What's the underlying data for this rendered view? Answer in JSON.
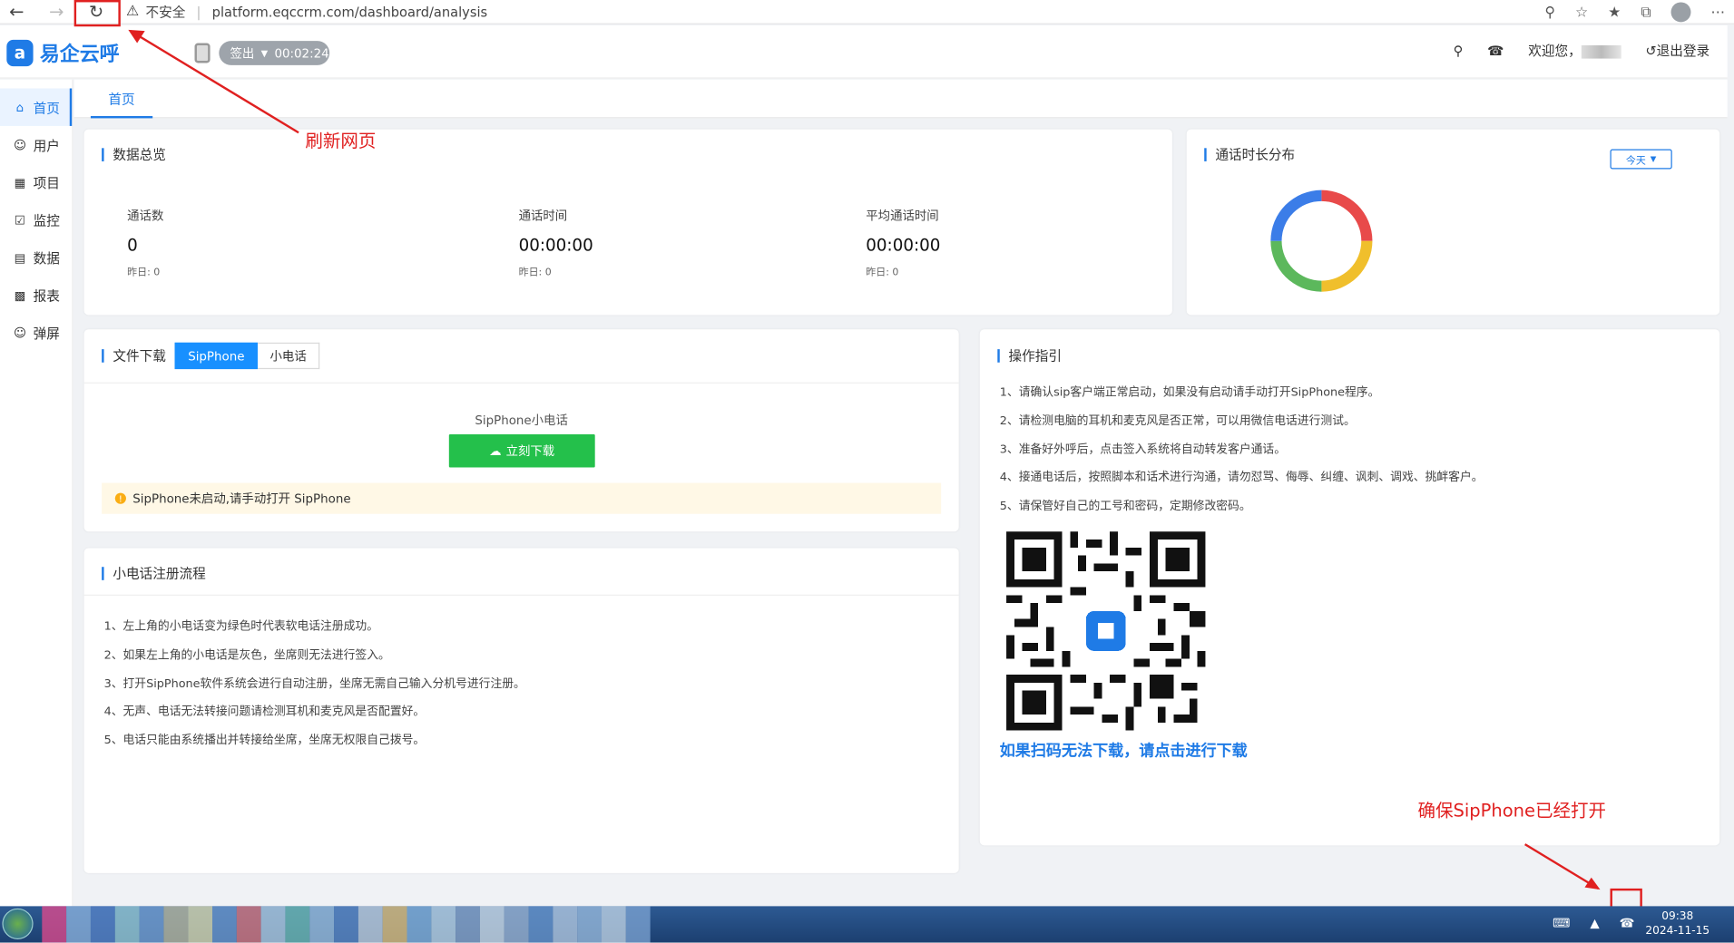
{
  "browser": {
    "security": "不安全",
    "url": "platform.eqccrm.com/dashboard/analysis"
  },
  "header": {
    "brand": "易企云呼",
    "signout_label": "签出",
    "timer": "00:02:24",
    "welcome": "欢迎您，",
    "logout": "退出登录"
  },
  "sidebar": {
    "items": [
      {
        "label": "首页",
        "icon": "home-icon"
      },
      {
        "label": "用户",
        "icon": "user-icon"
      },
      {
        "label": "项目",
        "icon": "project-icon"
      },
      {
        "label": "监控",
        "icon": "monitor-icon"
      },
      {
        "label": "数据",
        "icon": "data-icon"
      },
      {
        "label": "报表",
        "icon": "report-icon"
      },
      {
        "label": "弹屏",
        "icon": "popup-icon"
      }
    ]
  },
  "tabs": [
    {
      "label": "首页"
    }
  ],
  "overview": {
    "title": "数据总览",
    "stats": [
      {
        "label": "通话数",
        "value": "0",
        "yesterday": "昨日: 0"
      },
      {
        "label": "通话时间",
        "value": "00:00:00",
        "yesterday": "昨日: 0"
      },
      {
        "label": "平均通话时间",
        "value": "00:00:00",
        "yesterday": "昨日: 0"
      }
    ]
  },
  "duration": {
    "title": "通话时长分布",
    "range": "今天",
    "colors": [
      "#e84a4a",
      "#f0bf2c",
      "#5cb85c",
      "#3b7de8"
    ]
  },
  "download": {
    "title": "文件下载",
    "tabs": [
      "SipPhone",
      "小电话"
    ],
    "item_title": "SipPhone小电话",
    "button": "立刻下载",
    "alert": "SipPhone未启动,请手动打开 SipPhone"
  },
  "register": {
    "title": "小电话注册流程",
    "steps": [
      "1、左上角的小电话变为绿色时代表软电话注册成功。",
      "2、如果左上角的小电话是灰色，坐席则无法进行签入。",
      "3、打开SipPhone软件系统会进行自动注册，坐席无需自己输入分机号进行注册。",
      "4、无声、电话无法转接问题请检测耳机和麦克风是否配置好。",
      "5、电话只能由系统播出并转接给坐席，坐席无权限自己拨号。"
    ]
  },
  "guide": {
    "title": "操作指引",
    "steps": [
      "1、请确认sip客户端正常启动，如果没有启动请手动打开SipPhone程序。",
      "2、请检测电脑的耳机和麦克风是否正常，可以用微信电话进行测试。",
      "3、准备好外呼后，点击签入系统将自动转发客户通话。",
      "4、接通电话后，按照脚本和话术进行沟通，请勿怼骂、侮辱、纠缠、讽刺、调戏、挑衅客户。",
      "5、请保管好自己的工号和密码，定期修改密码。"
    ],
    "qr_link": "如果扫码无法下载，请点击进行下载"
  },
  "annotations": {
    "refresh": "刷新网页",
    "sipphone": "确保SipPhone已经打开"
  },
  "taskbar": {
    "time": "09:38",
    "date": "2024-11-15"
  }
}
